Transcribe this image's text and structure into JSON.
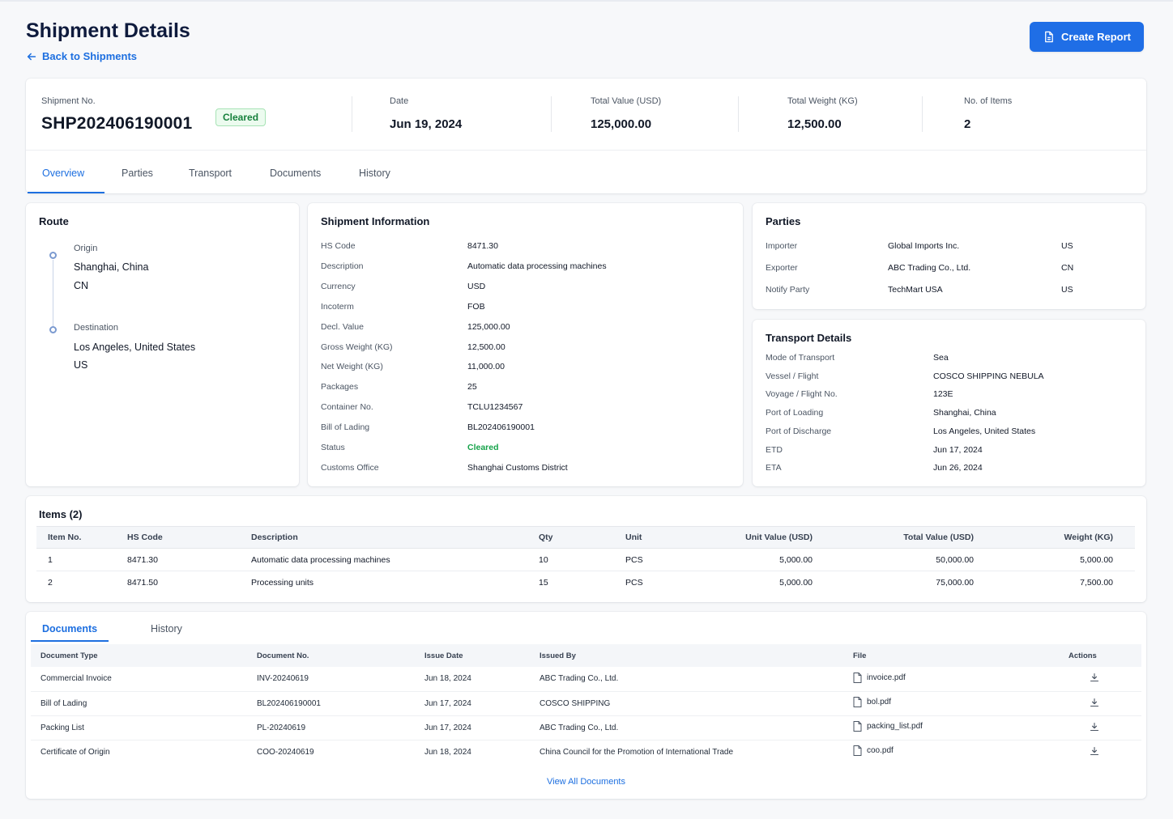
{
  "header": {
    "title": "Shipment Details",
    "back_label": "Back to Shipments",
    "create_report_label": "Create Report"
  },
  "summary": {
    "shipment_no_label": "Shipment No.",
    "shipment_no": "SHP202406190001",
    "status_badge": "Cleared",
    "date_label": "Date",
    "date": "Jun 19, 2024",
    "total_value_label": "Total Value (USD)",
    "total_value": "125,000.00",
    "total_weight_label": "Total Weight (KG)",
    "total_weight": "12,500.00",
    "items_label": "No. of Items",
    "items_count": "2"
  },
  "tabs": [
    "Overview",
    "Parties",
    "Transport",
    "Documents",
    "History"
  ],
  "route": {
    "title": "Route",
    "origin_label": "Origin",
    "origin_city": "Shanghai, China",
    "origin_country": "CN",
    "destination_label": "Destination",
    "destination_city": "Los Angeles, United States",
    "destination_country": "US"
  },
  "shipment_info": {
    "title": "Shipment Information",
    "rows": [
      {
        "label": "HS Code",
        "value": "8471.30"
      },
      {
        "label": "Description",
        "value": "Automatic data processing machines"
      },
      {
        "label": "Currency",
        "value": "USD"
      },
      {
        "label": "Incoterm",
        "value": "FOB"
      },
      {
        "label": "Decl. Value",
        "value": "125,000.00"
      },
      {
        "label": "Gross Weight (KG)",
        "value": "12,500.00"
      },
      {
        "label": "Net Weight (KG)",
        "value": "11,000.00"
      },
      {
        "label": "Packages",
        "value": "25"
      },
      {
        "label": "Container No.",
        "value": "TCLU1234567"
      },
      {
        "label": "Bill of Lading",
        "value": "BL202406190001"
      },
      {
        "label": "Status",
        "value": "Cleared"
      },
      {
        "label": "Customs Office",
        "value": "Shanghai Customs District"
      }
    ]
  },
  "parties": {
    "title": "Parties",
    "rows": [
      {
        "role": "Importer",
        "name": "Global Imports Inc.",
        "country": "US"
      },
      {
        "role": "Exporter",
        "name": "ABC Trading Co., Ltd.",
        "country": "CN"
      },
      {
        "role": "Notify Party",
        "name": "TechMart USA",
        "country": "US"
      }
    ]
  },
  "transport": {
    "title": "Transport Details",
    "rows": [
      {
        "label": "Mode of Transport",
        "value": "Sea"
      },
      {
        "label": "Vessel / Flight",
        "value": "COSCO SHIPPING NEBULA"
      },
      {
        "label": "Voyage / Flight No.",
        "value": "123E"
      },
      {
        "label": "Port of Loading",
        "value": "Shanghai, China"
      },
      {
        "label": "Port of Discharge",
        "value": "Los Angeles, United States"
      },
      {
        "label": "ETD",
        "value": "Jun 17, 2024"
      },
      {
        "label": "ETA",
        "value": "Jun 26, 2024"
      }
    ]
  },
  "items": {
    "title": "Items (2)",
    "columns": [
      "Item No.",
      "HS Code",
      "Description",
      "Qty",
      "Unit",
      "Unit Value (USD)",
      "Total Value (USD)",
      "Weight (KG)"
    ],
    "rows": [
      [
        "1",
        "8471.30",
        "Automatic data processing machines",
        "10",
        "PCS",
        "5,000.00",
        "50,000.00",
        "5,000.00"
      ],
      [
        "2",
        "8471.50",
        "Processing units",
        "15",
        "PCS",
        "5,000.00",
        "75,000.00",
        "7,500.00"
      ]
    ]
  },
  "documents": {
    "tabs": [
      "Documents",
      "History"
    ],
    "columns": [
      "Document Type",
      "Document No.",
      "Issue Date",
      "Issued By",
      "File",
      "Actions"
    ],
    "rows": [
      [
        "Commercial Invoice",
        "INV-20240619",
        "Jun 18, 2024",
        "ABC Trading Co., Ltd.",
        "invoice.pdf"
      ],
      [
        "Bill of Lading",
        "BL202406190001",
        "Jun 17, 2024",
        "COSCO SHIPPING",
        "bol.pdf"
      ],
      [
        "Packing List",
        "PL-20240619",
        "Jun 17, 2024",
        "ABC Trading Co., Ltd.",
        "packing_list.pdf"
      ],
      [
        "Certificate of Origin",
        "COO-20240619",
        "Jun 18, 2024",
        "China Council for the Promotion of International Trade",
        "coo.pdf"
      ]
    ],
    "view_all_label": "View All Documents"
  },
  "colors": {
    "accent": "#1d6fe0",
    "status_green": "#16a34a",
    "page_bg": "#f7f8fa"
  }
}
